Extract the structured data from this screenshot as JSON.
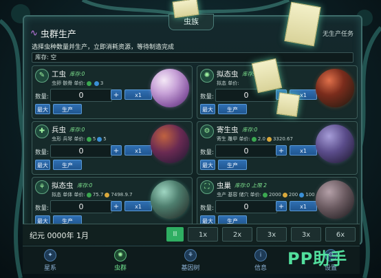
{
  "window": {
    "title": "虫族"
  },
  "header": {
    "title": "虫群生产",
    "status": "无生产任务",
    "instruction": "选择虫种数量并生产，立即消耗资源，等待制造完成",
    "inventory": "库存: 空"
  },
  "units": [
    {
      "name": "工虫",
      "stock": "库存:0",
      "costs_label": "虫卵 骸骨 单价:",
      "costs": [
        {
          "type": "green",
          "value": ""
        },
        {
          "type": "blue",
          "value": "3"
        }
      ],
      "qty_label": "数量:",
      "qty": "0",
      "plus": "+",
      "mult": "x1",
      "max": "最大",
      "produce": "生产",
      "orb_color": "#c8a3d8"
    },
    {
      "name": "拟态虫",
      "stock": "库存:0",
      "costs_label": "拟态 单价:",
      "costs": [],
      "qty_label": "数量:",
      "qty": "0",
      "plus": "+",
      "mult": "x1",
      "max": "最大",
      "produce": "生产",
      "orb_color": "#7a2c1c"
    },
    {
      "name": "兵虫",
      "stock": "库存:0",
      "costs_label": "虫形 兵琴 单价:",
      "costs": [
        {
          "type": "green",
          "value": "5"
        },
        {
          "type": "blue",
          "value": "5"
        }
      ],
      "qty_label": "数量:",
      "qty": "0",
      "plus": "+",
      "mult": "x1",
      "max": "最大",
      "produce": "生产",
      "orb_color": "#6a2a52"
    },
    {
      "name": "寄生虫",
      "stock": "库存:0",
      "costs_label": "寄生 雕甲 单价:",
      "costs": [
        {
          "type": "green",
          "value": "2.0"
        },
        {
          "type": "gold",
          "value": "3320.67"
        }
      ],
      "qty_label": "数量:",
      "qty": "0",
      "plus": "+",
      "mult": "x1",
      "max": "最大",
      "produce": "生产",
      "orb_color": "#5a4c8a"
    },
    {
      "name": "拟态虫",
      "stock": "库存:0",
      "costs_label": "拟态 单体 单价:",
      "costs": [
        {
          "type": "green",
          "value": "75.7"
        },
        {
          "type": "gold",
          "value": "7498.9.7"
        }
      ],
      "qty_label": "数量:",
      "qty": "0",
      "plus": "+",
      "mult": "x1",
      "max": "最大",
      "produce": "生产",
      "orb_color": "#4e7e6e"
    },
    {
      "name": "虫巢",
      "stock": "库存:0 上限 2",
      "costs_label": "虫产 基容 储穴 单价:",
      "costs": [
        {
          "type": "green",
          "value": "2000"
        },
        {
          "type": "gold",
          "value": "200"
        },
        {
          "type": "blue",
          "value": "100"
        }
      ],
      "qty_label": "数量:",
      "qty": "0",
      "plus": "+",
      "mult": "x1",
      "max": "最大",
      "produce": "生产",
      "orb_color": "#6a5a60"
    }
  ],
  "time": {
    "date": "纪元 0000年 1月",
    "pause": "II",
    "speeds": [
      "1x",
      "2x",
      "3x",
      "3x",
      "6x"
    ]
  },
  "nav": [
    {
      "label": "星系",
      "icon": "galaxy-icon",
      "active": false
    },
    {
      "label": "虫群",
      "icon": "swarm-icon",
      "active": true
    },
    {
      "label": "基因树",
      "icon": "gene-tree-icon",
      "active": false
    },
    {
      "label": "信息",
      "icon": "info-icon",
      "active": false
    },
    {
      "label": "设置",
      "icon": "settings-icon",
      "active": false
    }
  ],
  "watermark": "PP助手"
}
